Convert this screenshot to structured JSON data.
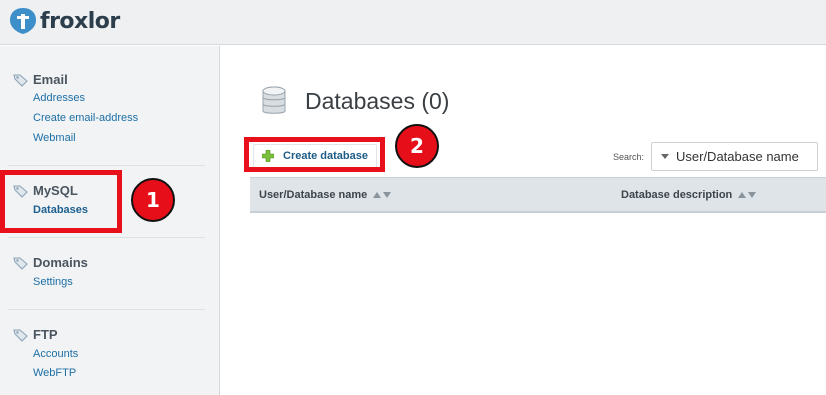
{
  "app": {
    "name": "froxlor"
  },
  "sidebar": {
    "groups": [
      {
        "title": "Email",
        "links": [
          "Addresses",
          "Create email-address",
          "Webmail"
        ]
      },
      {
        "title": "MySQL",
        "links": [
          "Databases"
        ]
      },
      {
        "title": "Domains",
        "links": [
          "Settings"
        ]
      },
      {
        "title": "FTP",
        "links": [
          "Accounts",
          "WebFTP"
        ]
      }
    ]
  },
  "main": {
    "page_title": "Databases (0)",
    "create_button_label": "Create database",
    "search": {
      "label": "Search:",
      "selected": "User/Database name"
    },
    "table": {
      "columns": [
        "User/Database name",
        "Database description"
      ]
    }
  },
  "annotations": [
    "1",
    "2"
  ],
  "colors": {
    "annotation": "#e8101a",
    "link": "#1d6fa5",
    "brand": "#2c3e4c",
    "brand_accent": "#3d8fc9"
  },
  "icons": [
    "froxlor-logo-icon",
    "tag-icon",
    "database-icon",
    "plus-icon",
    "dropdown-caret-icon",
    "sort-arrows-icon"
  ]
}
